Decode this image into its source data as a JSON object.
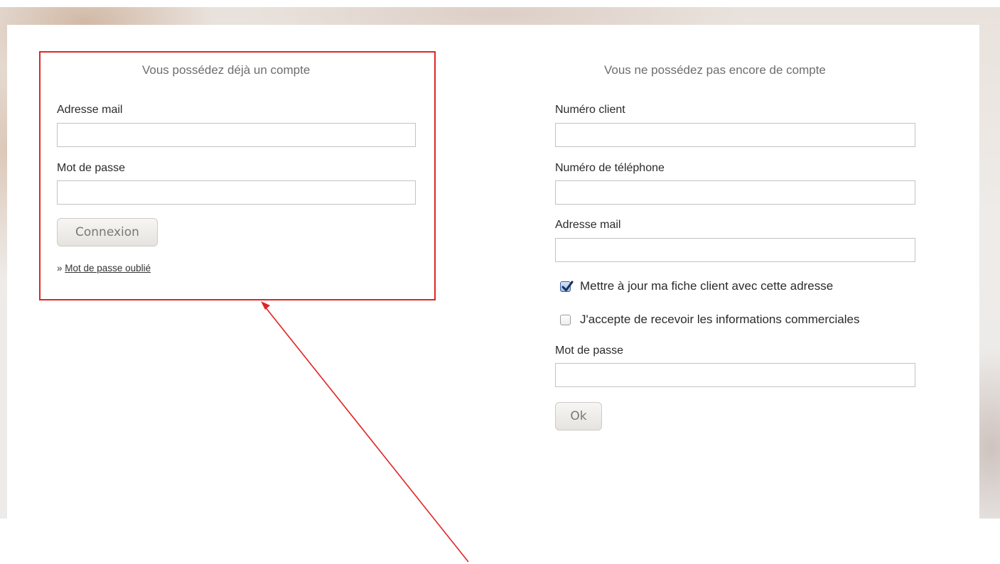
{
  "login": {
    "title": "Vous possédez déjà un compte",
    "email_label": "Adresse mail",
    "email_value": "",
    "password_label": "Mot de passe",
    "password_value": "",
    "submit_label": "Connexion",
    "forgot_prefix": "»",
    "forgot_label": "Mot de passe oublié"
  },
  "register": {
    "title": "Vous ne possédez pas encore de compte",
    "client_number_label": "Numéro client",
    "client_number_value": "",
    "phone_label": "Numéro de téléphone",
    "phone_value": "",
    "email_label": "Adresse mail",
    "email_value": "",
    "update_record": {
      "label": "Mettre à jour ma fiche client avec cette adresse",
      "checked": true
    },
    "accept_marketing": {
      "label": "J'accepte de recevoir les informations commerciales",
      "checked": false
    },
    "password_label": "Mot de passe",
    "password_value": "",
    "submit_label": "Ok"
  },
  "annotation": {
    "color": "#e02424",
    "icon": "arrow-icon"
  }
}
